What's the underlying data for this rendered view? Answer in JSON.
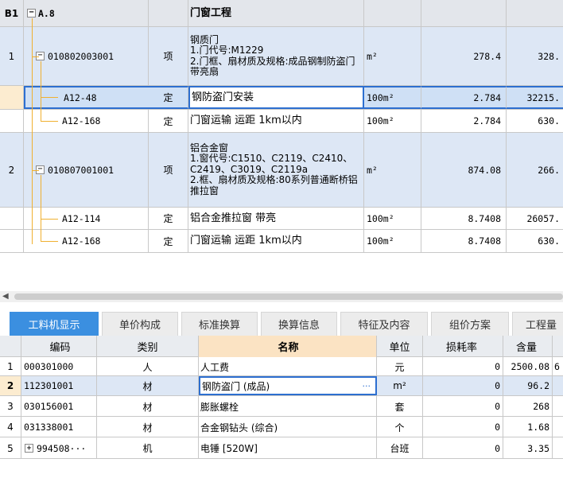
{
  "top_grid": {
    "header_row": {
      "index": "B1",
      "code": "A.8",
      "name": "门窗工程"
    },
    "rows": [
      {
        "index": "1",
        "code": "010802003001",
        "type": "项",
        "name": "钢质门\n1.门代号:M1229\n2.门框、扇材质及规格:成品钢制防盗门带亮扇",
        "unit": "m²",
        "qty": "278.4",
        "price": "328."
      },
      {
        "index": "",
        "code": "A12-48",
        "type": "定",
        "name": "钢防盗门安装",
        "unit": "100m²",
        "qty": "2.784",
        "price": "32215."
      },
      {
        "index": "",
        "code": "A12-168",
        "type": "定",
        "name": "门窗运输 运距 1km以内",
        "unit": "100m²",
        "qty": "2.784",
        "price": "630."
      },
      {
        "index": "2",
        "code": "010807001001",
        "type": "项",
        "name": "铝合金窗\n1.窗代号:C1510、C2119、C2410、C2419、C3019、C2119a\n2.框、扇材质及规格:80系列普通断桥铝推拉窗",
        "unit": "m²",
        "qty": "874.08",
        "price": "266."
      },
      {
        "index": "",
        "code": "A12-114",
        "type": "定",
        "name": "铝合金推拉窗 带亮",
        "unit": "100m²",
        "qty": "8.7408",
        "price": "26057."
      },
      {
        "index": "",
        "code": "A12-168",
        "type": "定",
        "name": "门窗运输 运距 1km以内",
        "unit": "100m²",
        "qty": "8.7408",
        "price": "630."
      }
    ]
  },
  "tabs": [
    "工料机显示",
    "单价构成",
    "标准换算",
    "换算信息",
    "特征及内容",
    "组价方案",
    "工程量"
  ],
  "bottom_grid": {
    "headers": {
      "code": "编码",
      "type": "类别",
      "name": "名称",
      "unit": "单位",
      "loss": "损耗率",
      "qty": "含量",
      "extra": ""
    },
    "rows": [
      {
        "index": "1",
        "code": "000301000",
        "type": "人",
        "name": "人工费",
        "unit": "元",
        "loss": "0",
        "qty": "2500.08",
        "extra": "6"
      },
      {
        "index": "2",
        "code": "112301001",
        "type": "材",
        "name": "钢防盗门 (成品)",
        "unit": "m²",
        "loss": "0",
        "qty": "96.2",
        "extra": ""
      },
      {
        "index": "3",
        "code": "030156001",
        "type": "材",
        "name": "膨胀螺栓",
        "unit": "套",
        "loss": "0",
        "qty": "268",
        "extra": ""
      },
      {
        "index": "4",
        "code": "031338001",
        "type": "材",
        "name": "合金钢钻头 (综合)",
        "unit": "个",
        "loss": "0",
        "qty": "1.68",
        "extra": ""
      },
      {
        "index": "5",
        "code": "994508···",
        "type": "机",
        "name": "电锤 [520W]",
        "unit": "台班",
        "loss": "0",
        "qty": "3.35",
        "extra": ""
      }
    ]
  },
  "icons": {
    "expand": "+",
    "collapse": "−",
    "ellipsis": "···",
    "scroll_left": "◀"
  }
}
